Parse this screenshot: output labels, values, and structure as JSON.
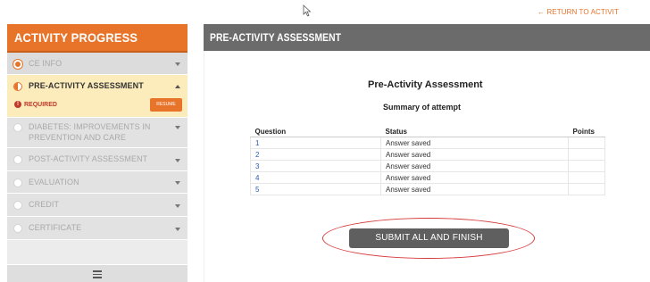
{
  "return_link": "← RETURN TO ACTIVIT",
  "sidebar": {
    "header": "ACTIVITY PROGRESS",
    "items": [
      {
        "label": "CE INFO"
      },
      {
        "label": "PRE-ACTIVITY ASSESSMENT",
        "required": "REQUIRED",
        "button": "RESUME"
      },
      {
        "label_line1": "DIABETES: IMPROVEMENTS IN",
        "label_line2": "PREVENTION AND CARE"
      },
      {
        "label": "POST-ACTIVITY ASSESSMENT"
      },
      {
        "label": "EVALUATION"
      },
      {
        "label": "CREDIT"
      },
      {
        "label": "CERTIFICATE"
      }
    ]
  },
  "panel": {
    "title": "PRE-ACTIVITY ASSESSMENT",
    "heading": "Pre-Activity Assessment",
    "subheading": "Summary of attempt",
    "columns": [
      "Question",
      "Status",
      "Points"
    ],
    "rows": [
      {
        "question": "1",
        "status": "Answer saved",
        "points": ""
      },
      {
        "question": "2",
        "status": "Answer saved",
        "points": ""
      },
      {
        "question": "3",
        "status": "Answer saved",
        "points": ""
      },
      {
        "question": "4",
        "status": "Answer saved",
        "points": ""
      },
      {
        "question": "5",
        "status": "Answer saved",
        "points": ""
      }
    ],
    "submit_label": "SUBMIT ALL AND FINISH"
  },
  "colors": {
    "accent": "#e8742a",
    "panel_header": "#6b6b6b",
    "active_item": "#fcebbb",
    "required": "#c0392b",
    "highlight_ring": "#d63a3a"
  },
  "icons": [
    "cursor-arrow-icon",
    "progress-circle-icon",
    "chevron-down-icon",
    "chevron-up-icon",
    "alert-icon",
    "hamburger-menu-icon"
  ]
}
